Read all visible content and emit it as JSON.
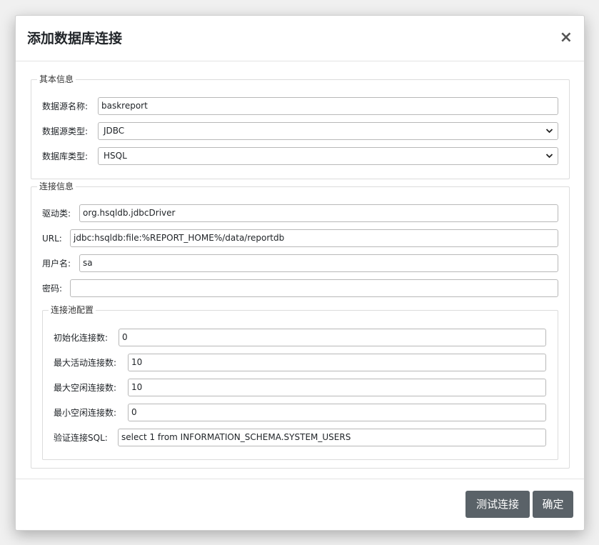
{
  "dialog": {
    "title": "添加数据库连接",
    "close_glyph": "×"
  },
  "basic_info": {
    "legend": "其本信息",
    "datasource_name": {
      "label": "数据源名称:",
      "value": "baskreport"
    },
    "datasource_type": {
      "label": "数据源类型:",
      "value": "JDBC"
    },
    "database_type": {
      "label": "数据库类型:",
      "value": "HSQL"
    }
  },
  "connection_info": {
    "legend": "连接信息",
    "driver": {
      "label": "驱动类:",
      "value": "org.hsqldb.jdbcDriver"
    },
    "url": {
      "label": "URL:",
      "value": "jdbc:hsqldb:file:%REPORT_HOME%/data/reportdb"
    },
    "username": {
      "label": "用户名:",
      "value": "sa"
    },
    "password": {
      "label": "密码:",
      "value": ""
    }
  },
  "pool_config": {
    "legend": "连接池配置",
    "initial_connections": {
      "label": "初始化连接数:",
      "value": "0"
    },
    "max_active": {
      "label": "最大活动连接数:",
      "value": "10"
    },
    "max_idle": {
      "label": "最大空闲连接数:",
      "value": "10"
    },
    "min_idle": {
      "label": "最小空闲连接数:",
      "value": "0"
    },
    "validation_sql": {
      "label": "验证连接SQL:",
      "value": "select 1 from INFORMATION_SCHEMA.SYSTEM_USERS"
    }
  },
  "footer": {
    "test_button": "测试连接",
    "confirm_button": "确定"
  },
  "icons": {
    "select_chevron": "chevron-down-icon"
  },
  "colors": {
    "button_bg": "#5a6268",
    "button_text": "#ffffff"
  }
}
